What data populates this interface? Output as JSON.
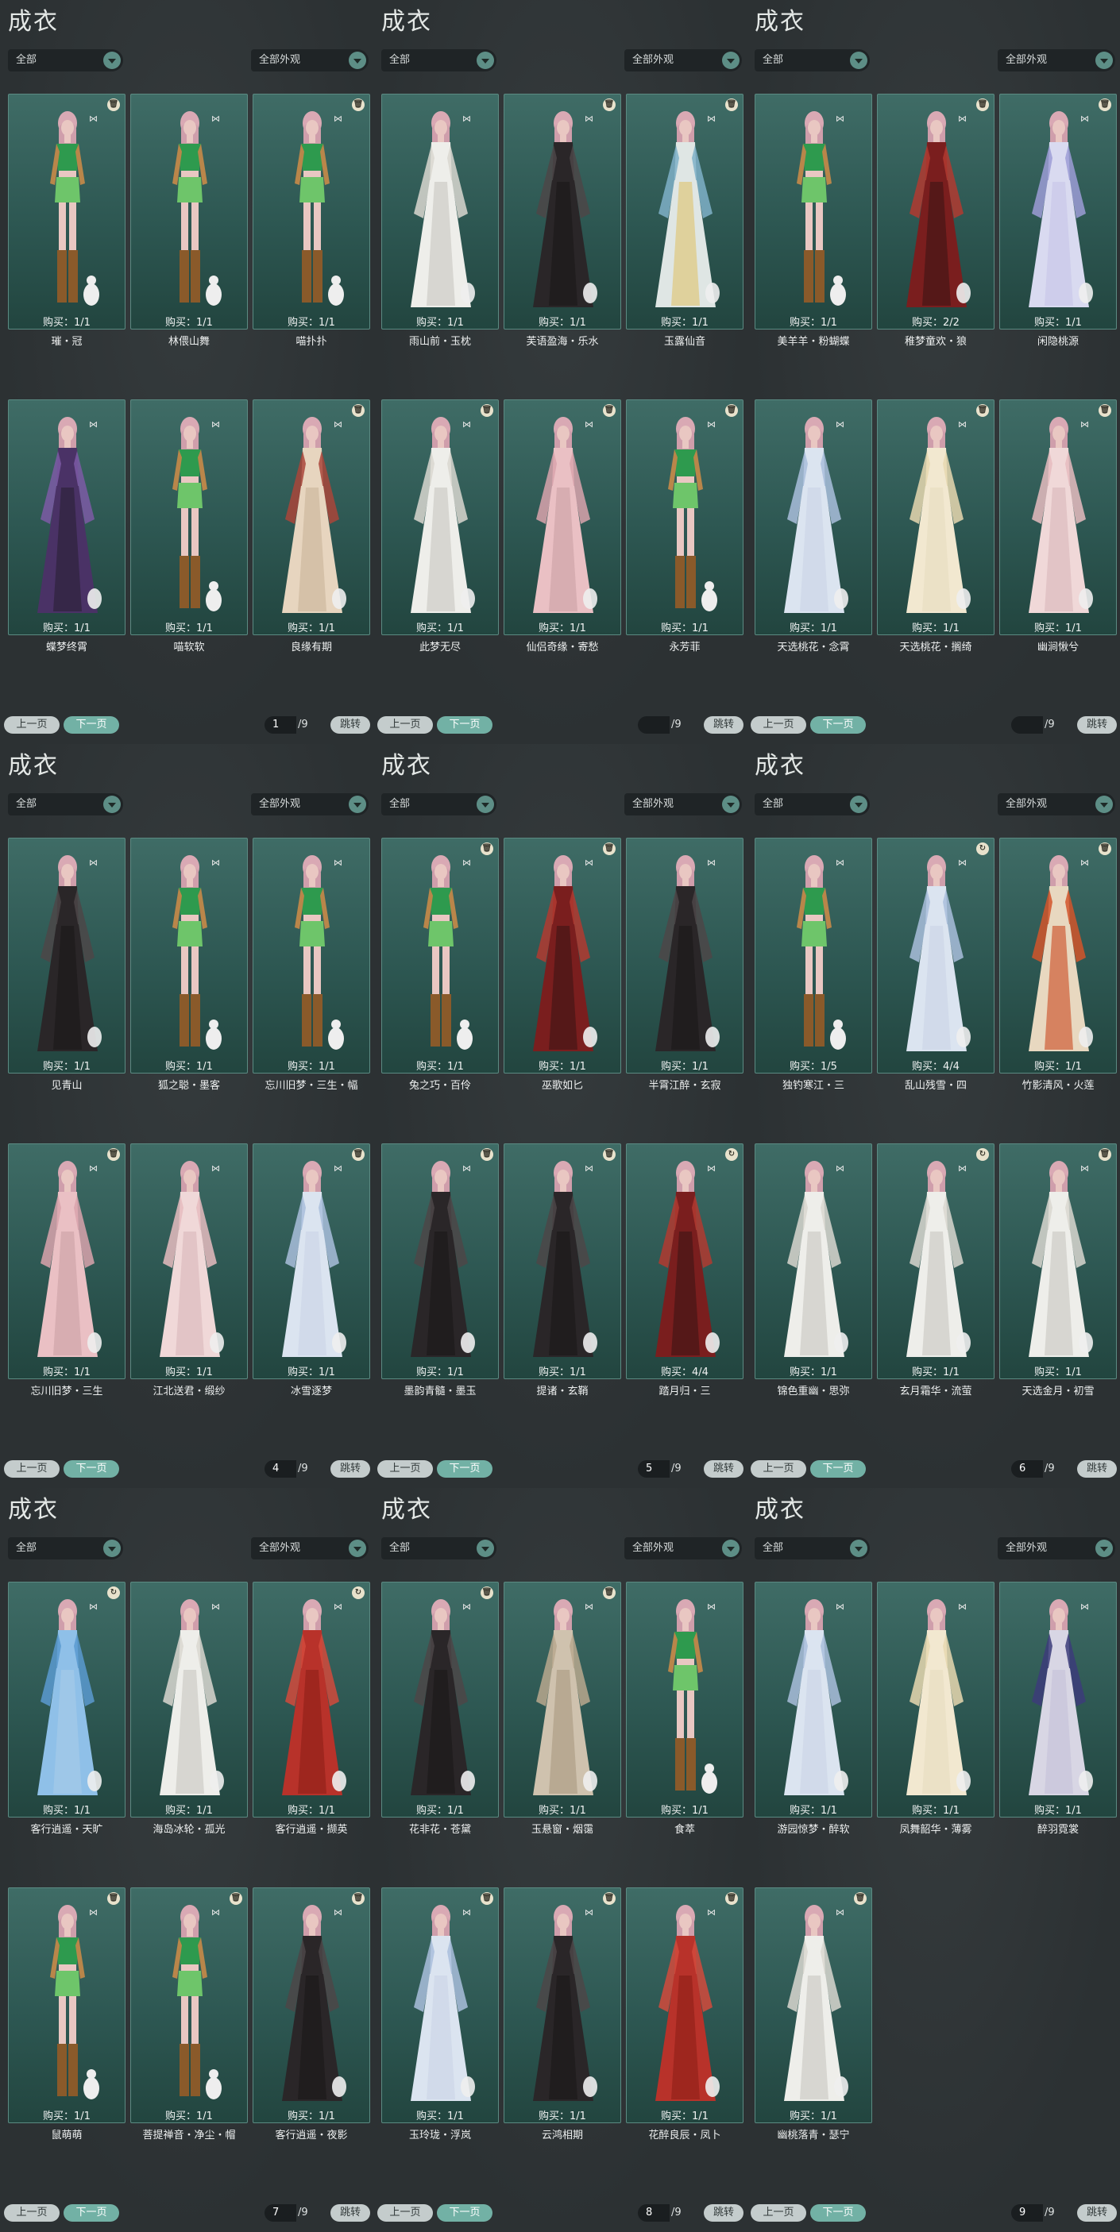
{
  "panel_title": "成衣",
  "filter_all": "全部",
  "filter_appearance": "全部外观",
  "pager": {
    "prev": "上一页",
    "next": "下一页",
    "jump": "跳转",
    "total": "/9"
  },
  "colors": {
    "accent": "#72b1a5",
    "card": "#2d5752",
    "background": "#2d3234"
  },
  "panels": [
    {
      "page": "1",
      "cards": [
        {
          "name": "璀・冠",
          "buy": "购买：1/1",
          "badge": "trash",
          "outfit": "green"
        },
        {
          "name": "林偎山舞",
          "buy": "购买：1/1",
          "badge": "none",
          "outfit": "green"
        },
        {
          "name": "喵扑扑",
          "buy": "购买：1/1",
          "badge": "trash",
          "outfit": "green"
        },
        {
          "name": "蝶梦终霄",
          "buy": "购买：1/1",
          "badge": "none",
          "outfit": "purple"
        },
        {
          "name": "喵软软",
          "buy": "购买：1/1",
          "badge": "none",
          "outfit": "green"
        },
        {
          "name": "良缘有期",
          "buy": "购买：1/1",
          "badge": "trash",
          "outfit": "cream-red"
        }
      ]
    },
    {
      "page": "",
      "cards": [
        {
          "name": "雨山前・玉枕",
          "buy": "购买：1/1",
          "badge": "none",
          "outfit": "white"
        },
        {
          "name": "芙语盈海・乐水",
          "buy": "购买：1/1",
          "badge": "trash",
          "outfit": "black"
        },
        {
          "name": "玉露仙音",
          "buy": "购买：1/1",
          "badge": "trash",
          "outfit": "blue-gold"
        },
        {
          "name": "此梦无尽",
          "buy": "购买：1/1",
          "badge": "trash",
          "outfit": "white"
        },
        {
          "name": "仙侣奇缘・寄愁",
          "buy": "购买：1/1",
          "badge": "trash",
          "outfit": "pink"
        },
        {
          "name": "永芳菲",
          "buy": "购买：1/1",
          "badge": "trash",
          "outfit": "green"
        }
      ]
    },
    {
      "page": "",
      "cards": [
        {
          "name": "美羊羊・粉蝴蝶",
          "buy": "购买：1/1",
          "badge": "none",
          "outfit": "green"
        },
        {
          "name": "稚梦童欢・狼",
          "buy": "购买：2/2",
          "badge": "trash",
          "outfit": "red-dark"
        },
        {
          "name": "闲隐桃源",
          "buy": "购买：1/1",
          "badge": "trash",
          "outfit": "lavender"
        },
        {
          "name": "天选桃花・念霄",
          "buy": "购买：1/1",
          "badge": "none",
          "outfit": "pale-blue"
        },
        {
          "name": "天选桃花・搁绮",
          "buy": "购买：1/1",
          "badge": "trash",
          "outfit": "cream"
        },
        {
          "name": "幽涧愀兮",
          "buy": "购买：1/1",
          "badge": "trash",
          "outfit": "pink-light"
        }
      ]
    },
    {
      "page": "4",
      "cards": [
        {
          "name": "见青山",
          "buy": "购买：1/1",
          "badge": "none",
          "outfit": "black"
        },
        {
          "name": "狐之聪・墨客",
          "buy": "购买：1/1",
          "badge": "none",
          "outfit": "green"
        },
        {
          "name": "忘川旧梦・三生・幅",
          "buy": "购买：1/1",
          "badge": "none",
          "outfit": "green"
        },
        {
          "name": "忘川旧梦・三生",
          "buy": "购买：1/1",
          "badge": "trash",
          "outfit": "pink"
        },
        {
          "name": "江北送君・缎纱",
          "buy": "购买：1/1",
          "badge": "none",
          "outfit": "pink-light"
        },
        {
          "name": "冰雪逐梦",
          "buy": "购买：1/1",
          "badge": "trash",
          "outfit": "pale-blue"
        }
      ]
    },
    {
      "page": "5",
      "cards": [
        {
          "name": "兔之巧・百伶",
          "buy": "购买：1/1",
          "badge": "trash",
          "outfit": "green"
        },
        {
          "name": "巫歌如匕",
          "buy": "购买：1/1",
          "badge": "trash",
          "outfit": "red-dark"
        },
        {
          "name": "半霄江醉・玄寂",
          "buy": "购买：1/1",
          "badge": "none",
          "outfit": "black"
        },
        {
          "name": "墨韵青髓・墨玉",
          "buy": "购买：1/1",
          "badge": "trash",
          "outfit": "black"
        },
        {
          "name": "提诸・玄鞘",
          "buy": "购买：1/1",
          "badge": "trash",
          "outfit": "black"
        },
        {
          "name": "踏月归・三",
          "buy": "购买：4/4",
          "badge": "cycle",
          "outfit": "red-dark"
        }
      ]
    },
    {
      "page": "6",
      "cards": [
        {
          "name": "独钓寒江・三",
          "buy": "购买：1/5",
          "badge": "none",
          "outfit": "green"
        },
        {
          "name": "乱山残雪・四",
          "buy": "购买：4/4",
          "badge": "cycle",
          "outfit": "pale-blue"
        },
        {
          "name": "竹影清风・火莲",
          "buy": "购买：1/1",
          "badge": "trash",
          "outfit": "orange"
        },
        {
          "name": "锦色重幽・思弥",
          "buy": "购买：1/1",
          "badge": "none",
          "outfit": "white"
        },
        {
          "name": "玄月霜华・流萤",
          "buy": "购买：1/1",
          "badge": "cycle",
          "outfit": "white"
        },
        {
          "name": "天选金月・初雪",
          "buy": "购买：1/1",
          "badge": "trash",
          "outfit": "white"
        }
      ]
    },
    {
      "page": "7",
      "cards": [
        {
          "name": "客行逍遥・天旷",
          "buy": "购买：1/1",
          "badge": "cycle",
          "outfit": "blue"
        },
        {
          "name": "海岛冰轮・孤光",
          "buy": "购买：1/1",
          "badge": "none",
          "outfit": "white"
        },
        {
          "name": "客行逍遥・撷英",
          "buy": "购买：1/1",
          "badge": "cycle",
          "outfit": "red"
        },
        {
          "name": "鼠萌萌",
          "buy": "购买：1/1",
          "badge": "trash",
          "outfit": "green"
        },
        {
          "name": "菩提禅音・净尘・帽",
          "buy": "购买：1/1",
          "badge": "trash",
          "outfit": "green"
        },
        {
          "name": "客行逍遥・夜影",
          "buy": "购买：1/1",
          "badge": "trash",
          "outfit": "black"
        }
      ]
    },
    {
      "page": "8",
      "cards": [
        {
          "name": "花非花・苍黛",
          "buy": "购买：1/1",
          "badge": "trash",
          "outfit": "black"
        },
        {
          "name": "玉悬窗・烟霭",
          "buy": "购买：1/1",
          "badge": "trash",
          "outfit": "beige"
        },
        {
          "name": "食萃",
          "buy": "购买：1/1",
          "badge": "none",
          "outfit": "green"
        },
        {
          "name": "玉玲珑・浮岚",
          "buy": "购买：1/1",
          "badge": "trash",
          "outfit": "pale-blue"
        },
        {
          "name": "云鸿相期",
          "buy": "购买：1/1",
          "badge": "trash",
          "outfit": "black"
        },
        {
          "name": "花醉良辰・凤卜",
          "buy": "购买：1/1",
          "badge": "trash",
          "outfit": "red"
        }
      ]
    },
    {
      "page": "9",
      "cards": [
        {
          "name": "游园惊梦・醉软",
          "buy": "购买：1/1",
          "badge": "none",
          "outfit": "pale-blue"
        },
        {
          "name": "凤舞韶华・薄雾",
          "buy": "购买：1/1",
          "badge": "none",
          "outfit": "cream"
        },
        {
          "name": "醉羽霓裳",
          "buy": "购买：1/1",
          "badge": "none",
          "outfit": "navy"
        },
        {
          "name": "幽桃落青・瑟宁",
          "buy": "购买：1/1",
          "badge": "trash",
          "outfit": "white"
        }
      ]
    }
  ]
}
